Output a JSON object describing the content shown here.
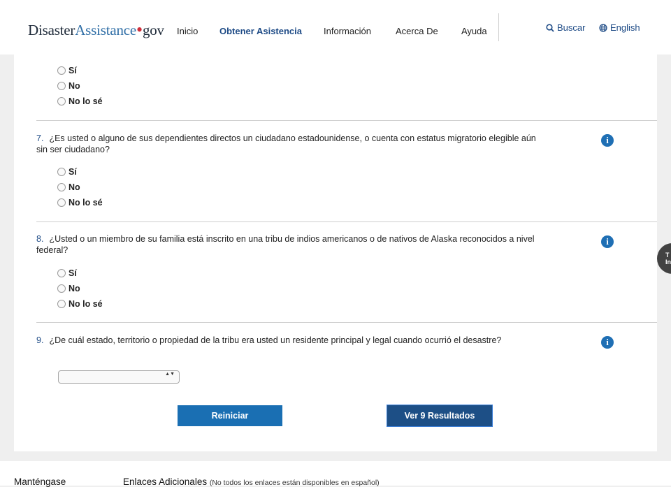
{
  "header": {
    "logo": {
      "part1": "Disaster",
      "part2": "Assistance",
      "dot": "•",
      "part3": "gov"
    },
    "nav": [
      "Inicio",
      "Obtener Asistencia",
      "Información",
      "Acerca De",
      "Ayuda"
    ],
    "search_label": "Buscar",
    "language_label": "English"
  },
  "radio_options": [
    "Sí",
    "No",
    "No lo sé"
  ],
  "questions": [
    {
      "number": "7.",
      "text": "¿Es usted o alguno de sus dependientes directos un ciudadano estadounidense, o cuenta con estatus migratorio elegible aún sin ser ciudadano?"
    },
    {
      "number": "8.",
      "text": "¿Usted o un miembro de su familia está inscrito en una tribu de indios americanos o de nativos de Alaska reconocidos a nivel federal?"
    },
    {
      "number": "9.",
      "text": "¿De cuál estado, territorio o propiedad de la tribu era usted un residente principal y legal cuando ocurrió el desastre?"
    }
  ],
  "select": {
    "value": "",
    "arrows": "▲▼"
  },
  "info_icon_glyph": "i",
  "buttons": {
    "reset": "Reiniciar",
    "results": "Ver 9 Resultados"
  },
  "side_badge": "T\nIn",
  "footer": {
    "col1": "Manténgase",
    "col2_title": "Enlaces Adicionales",
    "col2_note": "(No todos los enlaces están disponibles en español)"
  },
  "colors": {
    "accent": "#1e4b86",
    "button": "#1a6fb3",
    "button_dark": "#1d4f86",
    "info": "#1f6fb4",
    "logo_red": "#cf2e3a"
  }
}
